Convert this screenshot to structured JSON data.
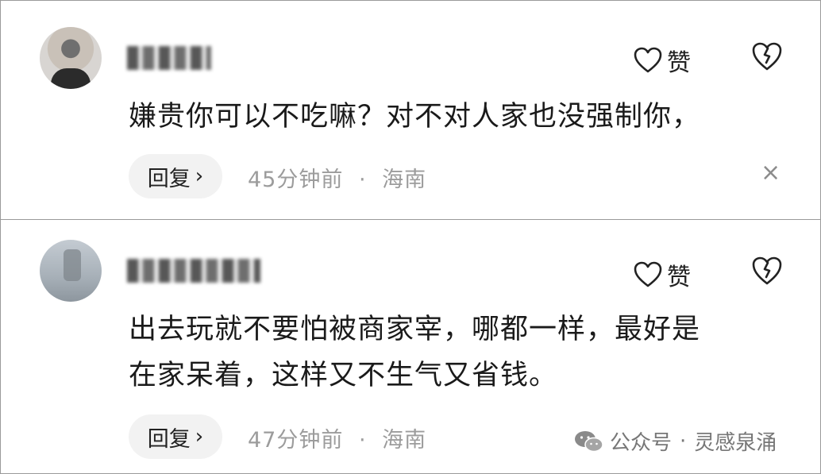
{
  "comments": [
    {
      "username": "",
      "text_lines": [
        "嫌贵你可以不吃嘛？对不对人家也没强制你，"
      ],
      "like_label": "赞",
      "reply_label": "回复",
      "reply_chevron": "›",
      "time": "45分钟前",
      "separator": "·",
      "location": "海南",
      "close": "×"
    },
    {
      "username": "",
      "text_lines": [
        "出去玩就不要怕被商家宰，哪都一样，最好是",
        "在家呆着，这样又不生气又省钱。"
      ],
      "like_label": "赞",
      "reply_label": "回复",
      "reply_chevron": "›",
      "time": "47分钟前",
      "separator": "·",
      "location": "海南"
    }
  ],
  "watermark": {
    "prefix": "公众号",
    "separator": "·",
    "name": "灵感泉涌"
  },
  "icons": {
    "like": "heart-outline-icon",
    "dislike": "broken-heart-icon",
    "wechat": "wechat-icon"
  }
}
